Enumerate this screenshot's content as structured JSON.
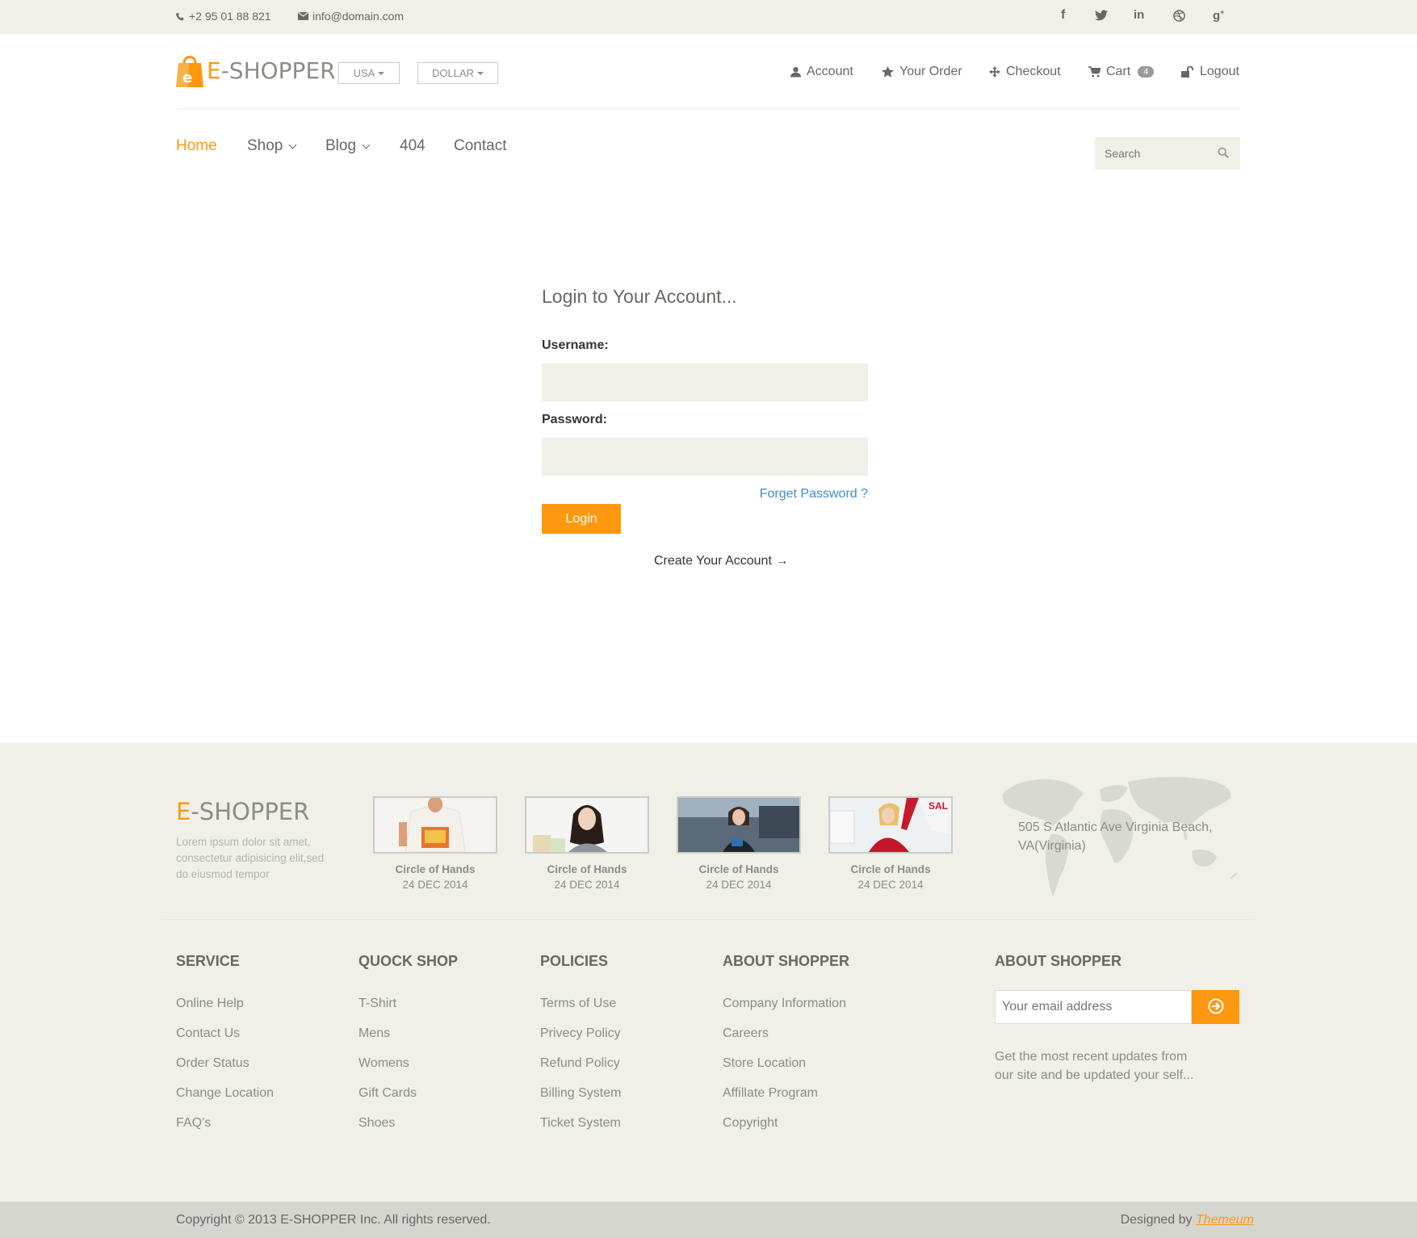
{
  "topbar": {
    "phone": "+2 95 01 88 821",
    "email": "info@domain.com",
    "social": [
      "facebook",
      "twitter",
      "linkedin",
      "dribbble",
      "google-plus"
    ]
  },
  "header": {
    "logo_prefix": "E",
    "logo_suffix": "-SHOPPER",
    "country": "USA",
    "currency": "DOLLAR",
    "links": {
      "account": "Account",
      "order": "Your Order",
      "checkout": "Checkout",
      "cart": "Cart",
      "cart_count": "4",
      "logout": "Logout"
    }
  },
  "nav": {
    "home": "Home",
    "shop": "Shop",
    "blog": "Blog",
    "notfound": "404",
    "contact": "Contact",
    "search_placeholder": "Search"
  },
  "login": {
    "title": "Login to Your Account...",
    "username_label": "Username:",
    "password_label": "Password:",
    "forgot": "Forget Password ?",
    "button": "Login",
    "create": "Create Your Account →"
  },
  "footer": {
    "logo_prefix": "E",
    "logo_suffix": "-SHOPPER",
    "description": "Lorem ipsum dolor sit amet, consectetur adipisicing elit,sed do eiusmod tempor",
    "videos": [
      {
        "title": "Circle of Hands",
        "date": "24 DEC 2014"
      },
      {
        "title": "Circle of Hands",
        "date": "24 DEC 2014"
      },
      {
        "title": "Circle of Hands",
        "date": "24 DEC 2014"
      },
      {
        "title": "Circle of Hands",
        "date": "24 DEC 2014"
      }
    ],
    "address": "505 S Atlantic Ave Virginia Beach, VA(Virginia)",
    "columns": [
      {
        "title": "SERVICE",
        "links": [
          "Online Help",
          "Contact Us",
          "Order Status",
          "Change Location",
          "FAQ’s"
        ]
      },
      {
        "title": "QUOCK SHOP",
        "links": [
          "T-Shirt",
          "Mens",
          "Womens",
          "Gift Cards",
          "Shoes"
        ]
      },
      {
        "title": "POLICIES",
        "links": [
          "Terms of Use",
          "Privecy Policy",
          "Refund Policy",
          "Billing System",
          "Ticket System"
        ]
      },
      {
        "title": "ABOUT SHOPPER",
        "links": [
          "Company Information",
          "Careers",
          "Store Location",
          "Affillate Program",
          "Copyright"
        ]
      }
    ],
    "newsletter": {
      "title": "ABOUT SHOPPER",
      "placeholder": "Your email address",
      "description": "Get the most recent updates from our site and be updated your self..."
    },
    "copyright": "Copyright © 2013 E-SHOPPER Inc. All rights reserved.",
    "designed_by": "Designed by",
    "designer": "Themeum"
  },
  "colors": {
    "accent": "#FE980F",
    "link": "#428bca",
    "footer_bg": "#F0F0E9",
    "bottom_bg": "#D6D6D0"
  }
}
